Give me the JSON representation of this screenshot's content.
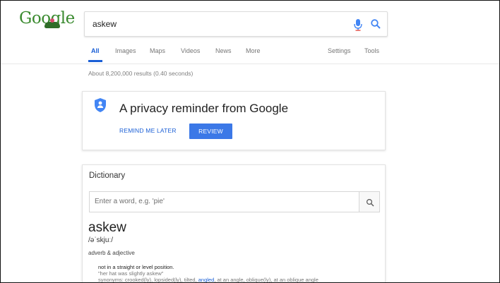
{
  "logo": {
    "text": "Google"
  },
  "search": {
    "query": "askew"
  },
  "tabs": {
    "items": [
      "All",
      "Images",
      "Maps",
      "Videos",
      "News",
      "More"
    ],
    "settings": "Settings",
    "tools": "Tools"
  },
  "result_stats": "About 8,200,000 results (0.40 seconds)",
  "privacy": {
    "title": "A privacy reminder from Google",
    "remind_label": "REMIND ME LATER",
    "review_label": "REVIEW",
    "accent": "#3b78e7"
  },
  "dictionary": {
    "heading": "Dictionary",
    "placeholder": "Enter a word, e.g. 'pie'",
    "word": "askew",
    "phonetic": "/əˈskjuː/",
    "part_of_speech": "adverb & adjective",
    "definition": "not in a straight or level position.",
    "example": "\"her hat was slightly askew\"",
    "synonyms_prefix": "synonyms: crooked(ly), lopsided(ly), tilted,",
    "synonym_highlight": "angled",
    "synonyms_suffix": ", at an angle, oblique(ly), at an oblique angle"
  },
  "icons": {
    "mic": "mic-icon",
    "search": "search-icon",
    "shield": "shield-icon"
  }
}
